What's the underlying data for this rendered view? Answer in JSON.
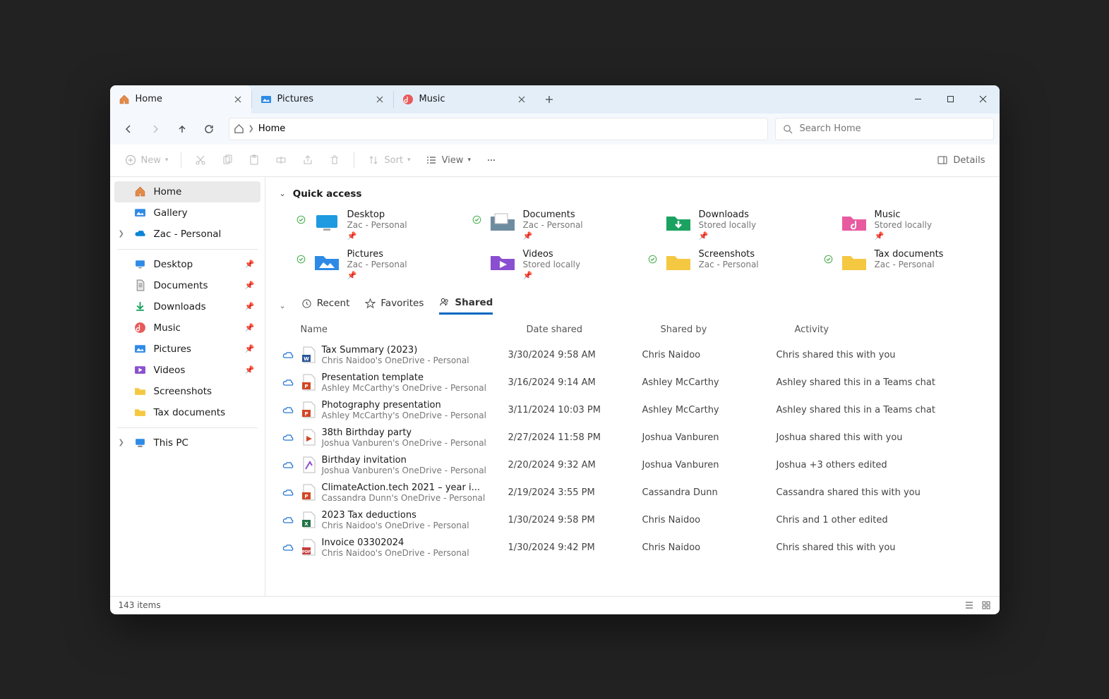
{
  "tabs": [
    {
      "label": "Home",
      "active": true
    },
    {
      "label": "Pictures",
      "active": false
    },
    {
      "label": "Music",
      "active": false
    }
  ],
  "address": {
    "location": "Home"
  },
  "search": {
    "placeholder": "Search Home"
  },
  "toolbar": {
    "new": "New",
    "sort": "Sort",
    "view": "View",
    "details": "Details"
  },
  "sidebar": {
    "top": [
      {
        "label": "Home",
        "active": true
      },
      {
        "label": "Gallery"
      },
      {
        "label": "Zac - Personal",
        "expand": true
      }
    ],
    "pinned": [
      {
        "label": "Desktop"
      },
      {
        "label": "Documents"
      },
      {
        "label": "Downloads"
      },
      {
        "label": "Music"
      },
      {
        "label": "Pictures"
      },
      {
        "label": "Videos"
      },
      {
        "label": "Screenshots"
      },
      {
        "label": "Tax documents"
      }
    ],
    "bottom": [
      {
        "label": "This PC",
        "expand": true
      }
    ]
  },
  "quick_access": {
    "title": "Quick access",
    "items": [
      {
        "title": "Desktop",
        "sub": "Zac - Personal",
        "pinned": true,
        "sync": true,
        "color": "#1e9ae0"
      },
      {
        "title": "Documents",
        "sub": "Zac - Personal",
        "pinned": true,
        "sync": true,
        "color": "#6e8ca0"
      },
      {
        "title": "Downloads",
        "sub": "Stored locally",
        "pinned": true,
        "sync": false,
        "color": "#1aa260"
      },
      {
        "title": "Music",
        "sub": "Stored locally",
        "pinned": true,
        "sync": false,
        "color": "#e85aa0"
      },
      {
        "title": "Pictures",
        "sub": "Zac - Personal",
        "pinned": true,
        "sync": true,
        "color": "#2e8ae6"
      },
      {
        "title": "Videos",
        "sub": "Stored locally",
        "pinned": true,
        "sync": false,
        "color": "#8a4fd0"
      },
      {
        "title": "Screenshots",
        "sub": "Zac - Personal",
        "pinned": false,
        "sync": true,
        "color": "#f5c842"
      },
      {
        "title": "Tax documents",
        "sub": "Zac - Personal",
        "pinned": false,
        "sync": true,
        "color": "#f5c842"
      }
    ]
  },
  "file_tabs": {
    "recent": "Recent",
    "favorites": "Favorites",
    "shared": "Shared"
  },
  "columns": {
    "name": "Name",
    "date": "Date shared",
    "by": "Shared by",
    "activity": "Activity"
  },
  "files": [
    {
      "name": "Tax Summary (2023)",
      "loc": "Chris Naidoo's OneDrive - Personal",
      "date": "3/30/2024 9:58 AM",
      "by": "Chris Naidoo",
      "act": "Chris shared this with you",
      "type": "word"
    },
    {
      "name": "Presentation template",
      "loc": "Ashley McCarthy's OneDrive - Personal",
      "date": "3/16/2024 9:14 AM",
      "by": "Ashley McCarthy",
      "act": "Ashley shared this in a Teams chat",
      "type": "ppt"
    },
    {
      "name": "Photography presentation",
      "loc": "Ashley McCarthy's OneDrive - Personal",
      "date": "3/11/2024 10:03 PM",
      "by": "Ashley McCarthy",
      "act": "Ashley shared this in a Teams chat",
      "type": "ppt"
    },
    {
      "name": "38th Birthday party",
      "loc": "Joshua Vanburen's OneDrive - Personal",
      "date": "2/27/2024 11:58 PM",
      "by": "Joshua Vanburen",
      "act": "Joshua shared this with you",
      "type": "video"
    },
    {
      "name": "Birthday invitation",
      "loc": "Joshua Vanburen's OneDrive - Personal",
      "date": "2/20/2024 9:32 AM",
      "by": "Joshua Vanburen",
      "act": "Joshua +3 others edited",
      "type": "design"
    },
    {
      "name": "ClimateAction.tech 2021 – year i...",
      "loc": "Cassandra Dunn's OneDrive - Personal",
      "date": "2/19/2024 3:55 PM",
      "by": "Cassandra Dunn",
      "act": "Cassandra shared this with you",
      "type": "ppt"
    },
    {
      "name": "2023 Tax deductions",
      "loc": "Chris Naidoo's OneDrive - Personal",
      "date": "1/30/2024 9:58 PM",
      "by": "Chris Naidoo",
      "act": "Chris and 1 other edited",
      "type": "excel"
    },
    {
      "name": "Invoice 03302024",
      "loc": "Chris Naidoo's OneDrive - Personal",
      "date": "1/30/2024 9:42 PM",
      "by": "Chris Naidoo",
      "act": "Chris shared this with you",
      "type": "pdf"
    }
  ],
  "status": {
    "items": "143 items"
  }
}
